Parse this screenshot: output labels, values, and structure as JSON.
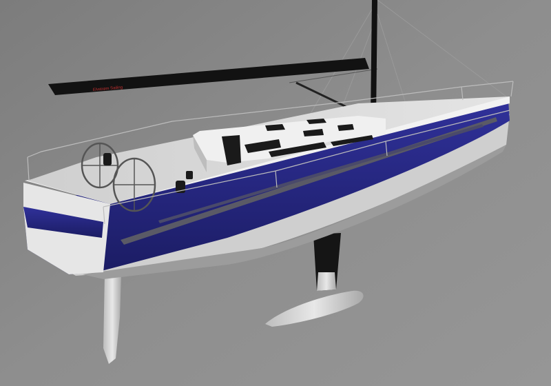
{
  "scene": {
    "subject": "sailboat-3d-render",
    "boom_text": "Elvstrøm Sailing",
    "colors": {
      "background": "#8a8a8a",
      "hull_band": "#2a2b8a",
      "hull_band_dark": "#1c1d66",
      "topsides": "#e8e8e8",
      "deck": "#d6d6d6",
      "spars": "#101010",
      "accent_red": "#c23030",
      "underbody": "#cfcfcf"
    }
  }
}
